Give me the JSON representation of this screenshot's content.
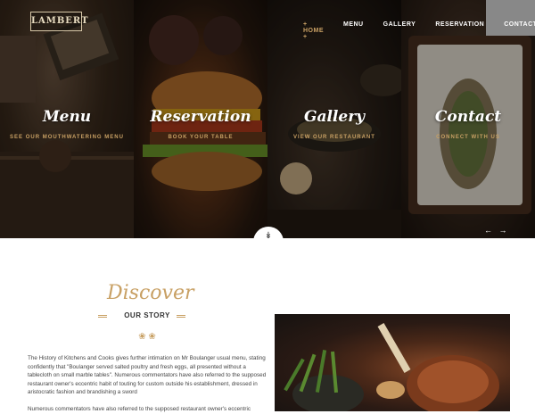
{
  "brand": {
    "logo": "LAMBERT"
  },
  "nav": {
    "items": [
      {
        "label": "HOME",
        "active": true
      },
      {
        "label": "MENU",
        "active": false
      },
      {
        "label": "GALLERY",
        "active": false
      },
      {
        "label": "RESERVATION",
        "active": false
      },
      {
        "label": "CONTACT",
        "active": false
      }
    ]
  },
  "hero": {
    "panels": [
      {
        "title": "Menu",
        "subtitle": "SEE OUR MOUTHWATERING MENU",
        "icon": "menu-photo"
      },
      {
        "title": "Reservation",
        "subtitle": "BOOK YOUR TABLE",
        "icon": "burger-photo"
      },
      {
        "title": "Gallery",
        "subtitle": "VIEW OUR RESTAURANT",
        "icon": "gallery-photo"
      },
      {
        "title": "Contact",
        "subtitle": "CONNECT WITH US",
        "icon": "contact-photo"
      }
    ],
    "scroll_icon": "double-chevron-down-icon"
  },
  "discover": {
    "heading": "Discover",
    "subheading": "OUR STORY",
    "paragraph1": "The History of Kitchens and Cooks gives further intimation on Mr Boulanger usual menu, stating confidently that \"Boulanger served salted poultry and fresh eggs, all presented without a tablecloth on small marble tables\". Numerous commentators have also referred to the supposed restaurant owner's eccentric habit of touting for custom outside his establishment, dressed in aristocratic fashion and brandishing a sword",
    "paragraph2": "Numerous commentators have also referred to the supposed restaurant owner's eccentric"
  },
  "colors": {
    "accent": "#c8a064",
    "text": "#444444"
  }
}
